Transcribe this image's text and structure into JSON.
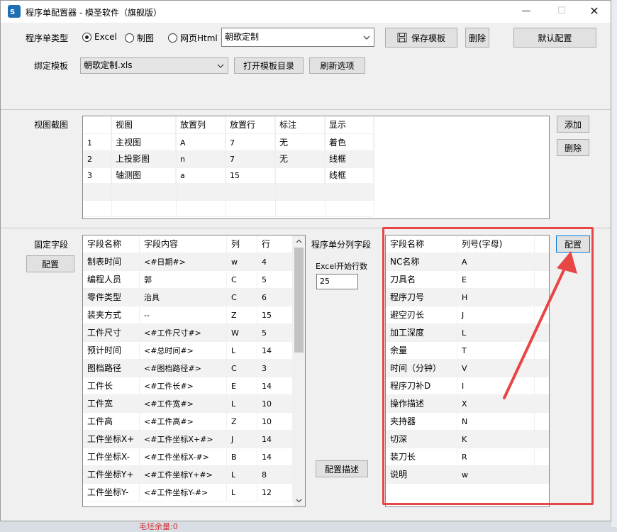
{
  "window": {
    "title": "程序单配置器 - 模圣软件（旗舰版）",
    "controls": [
      "—",
      "☐",
      "✕"
    ]
  },
  "top": {
    "type_label": "程序单类型",
    "radio_options": [
      {
        "label": "Excel",
        "selected": true
      },
      {
        "label": "制图",
        "selected": false
      },
      {
        "label": "网页Html",
        "selected": false
      }
    ],
    "template_name": "朝歌定制",
    "save_template": "保存模板",
    "delete": "删除",
    "default_config": "默认配置",
    "bind_label": "绑定模板",
    "bind_file": "朝歌定制.xls",
    "open_dir": "打开模板目录",
    "refresh": "刷新选项"
  },
  "view_section": {
    "label": "视图截图",
    "add": "添加",
    "delete": "删除",
    "headers": [
      "",
      "视图",
      "放置列",
      "放置行",
      "标注",
      "显示"
    ],
    "rows": [
      [
        "1",
        "主视图",
        "A",
        "7",
        "无",
        "着色"
      ],
      [
        "2",
        "上投影图",
        "n",
        "7",
        "无",
        "线框"
      ],
      [
        "3",
        "轴测图",
        "a",
        "15",
        "",
        "线框"
      ]
    ]
  },
  "fixed_section": {
    "label": "固定字段",
    "config": "配置",
    "headers": [
      "字段名称",
      "字段内容",
      "列",
      "行"
    ],
    "rows": [
      [
        "制表时间",
        "<#日期#>",
        "w",
        "4"
      ],
      [
        "编程人员",
        "郭",
        "C",
        "5"
      ],
      [
        "零件类型",
        "治具",
        "C",
        "6"
      ],
      [
        "装夹方式",
        "--",
        "Z",
        "15"
      ],
      [
        "工件尺寸",
        "<#工件尺寸#>",
        "W",
        "5"
      ],
      [
        "预计时间",
        "<#总时间#>",
        "L",
        "14"
      ],
      [
        "图档路径",
        "<#图档路径#>",
        "C",
        "3"
      ],
      [
        "工件长",
        "<#工件长#>",
        "E",
        "14"
      ],
      [
        "工件宽",
        "<#工件宽#>",
        "L",
        "10"
      ],
      [
        "工件高",
        "<#工件高#>",
        "Z",
        "10"
      ],
      [
        "工件坐标X+",
        "<#工件坐标X+#>",
        "J",
        "14"
      ],
      [
        "工件坐标X-",
        "<#工件坐标X-#>",
        "B",
        "14"
      ],
      [
        "工件坐标Y+",
        "<#工件坐标Y+#>",
        "L",
        "8"
      ],
      [
        "工件坐标Y-",
        "<#工件坐标Y-#>",
        "L",
        "12"
      ]
    ]
  },
  "split_section": {
    "label": "程序单分列字段",
    "excel_start_label": "Excel开始行数",
    "excel_start_value": "25",
    "config_desc": "配置描述",
    "config": "配置",
    "headers": [
      "字段名称",
      "列号(字母)"
    ],
    "rows": [
      [
        "NC名称",
        "A"
      ],
      [
        "刀具名",
        "E"
      ],
      [
        "程序刀号",
        "H"
      ],
      [
        "避空刃长",
        "J"
      ],
      [
        "加工深度",
        "L"
      ],
      [
        "余量",
        "T"
      ],
      [
        "时间（分钟）",
        "V"
      ],
      [
        "程序刀补D",
        "I"
      ],
      [
        "操作描述",
        "X"
      ],
      [
        "夹持器",
        "N"
      ],
      [
        "切深",
        "K"
      ],
      [
        "装刀长",
        "R"
      ],
      [
        "说明",
        "w"
      ]
    ]
  },
  "background_text": "毛坯余量:0",
  "colors": {
    "annotation_red": "#e84545",
    "window_bg": "#f0f0f0",
    "grid_alt_row": "#f2f2f2"
  }
}
